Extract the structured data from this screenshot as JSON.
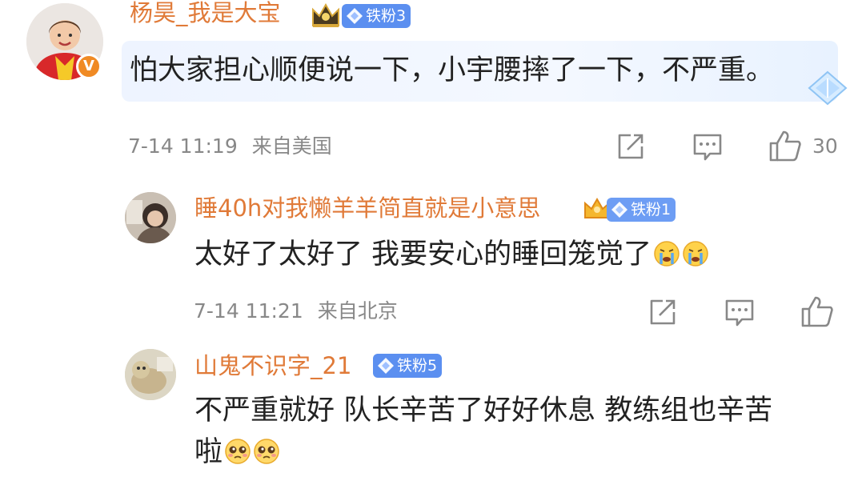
{
  "comments": [
    {
      "username": "杨昊_我是大宝",
      "badge": "铁粉3",
      "badge_color": "#5b8ff0",
      "verified_label": "V",
      "text": "怕大家担心顺便说一下，小宇腰摔了一下，不严重。",
      "time": "7-14 11:19",
      "location": "来自美国",
      "like_count": "30",
      "icons": [
        "crown-icon",
        "share-icon",
        "comment-icon",
        "like-icon"
      ]
    },
    {
      "username": "睡40h对我懒羊羊简直就是小意思",
      "badge": "铁粉1",
      "badge_color": "#6d9df4",
      "text": "太好了太好了 我要安心的睡回笼觉了",
      "time": "7-14 11:21",
      "location": "来自北京",
      "icons": [
        "crying-emoji",
        "crying-emoji",
        "share-icon",
        "comment-icon",
        "like-icon"
      ]
    },
    {
      "username": "山鬼不识字_21",
      "badge": "铁粉5",
      "badge_color": "#5b8ff0",
      "text_line1": "不严重就好 队长辛苦了好好休息 教练组也辛苦",
      "text_line2": "啦",
      "icons": [
        "pleading-emoji",
        "pleading-emoji"
      ]
    }
  ],
  "colors": {
    "username": "#e07a38",
    "text": "#222222",
    "meta": "#888888",
    "highlight_bg": "#eef4ff"
  }
}
